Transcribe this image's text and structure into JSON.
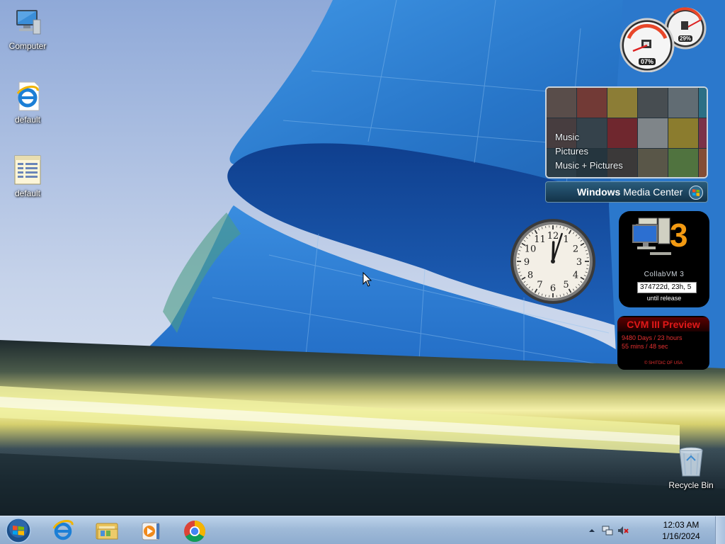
{
  "desktop": {
    "icons": [
      {
        "label": "Computer",
        "icon": "computer-icon"
      },
      {
        "label": "default",
        "icon": "internet-explorer-shortcut-icon"
      },
      {
        "label": "default",
        "icon": "document-file-icon"
      }
    ],
    "recycle_bin": {
      "label": "Recycle Bin",
      "icon": "recycle-bin-icon"
    }
  },
  "gadgets": {
    "cpu_meter": {
      "cpu_percent": "07%",
      "memory_percent": "29%"
    },
    "media_center": {
      "menu": [
        "Music",
        "Pictures",
        "Music + Pictures"
      ],
      "brand_strong": "Windows",
      "brand_light": " Media Center"
    },
    "clock": {
      "hour": 12,
      "minute": 3,
      "numerals": [
        "12",
        "1",
        "2",
        "3",
        "4",
        "5",
        "6",
        "7",
        "8",
        "9",
        "10",
        "11"
      ]
    },
    "collabvm3": {
      "big_number": "3",
      "title": "CollabVM 3",
      "countdown": "374722d, 23h, 5",
      "until": "until release"
    },
    "cvm_preview": {
      "title": "CVM III Preview",
      "line1": "9480 Days / 23 hours",
      "line2": "55 mins / 48 sec",
      "footer": "© SHITDIC OF USA"
    }
  },
  "taskbar": {
    "pinned": [
      {
        "name": "internet-explorer",
        "icon": "internet-explorer-icon"
      },
      {
        "name": "file-explorer",
        "icon": "folder-libraries-icon"
      },
      {
        "name": "media-player",
        "icon": "windows-media-player-icon"
      },
      {
        "name": "chrome",
        "icon": "chrome-icon"
      }
    ],
    "tray": {
      "time": "12:03 AM",
      "date": "1/16/2024",
      "icons": [
        "show-hidden-icons-arrow",
        "network-icon",
        "volume-muted-icon"
      ]
    }
  },
  "colors": {
    "taskbar_top": "#bcd2ea",
    "sky": "#a9bfe0",
    "building_blue": "#2f7fd0",
    "cvm_red": "#e01818"
  }
}
